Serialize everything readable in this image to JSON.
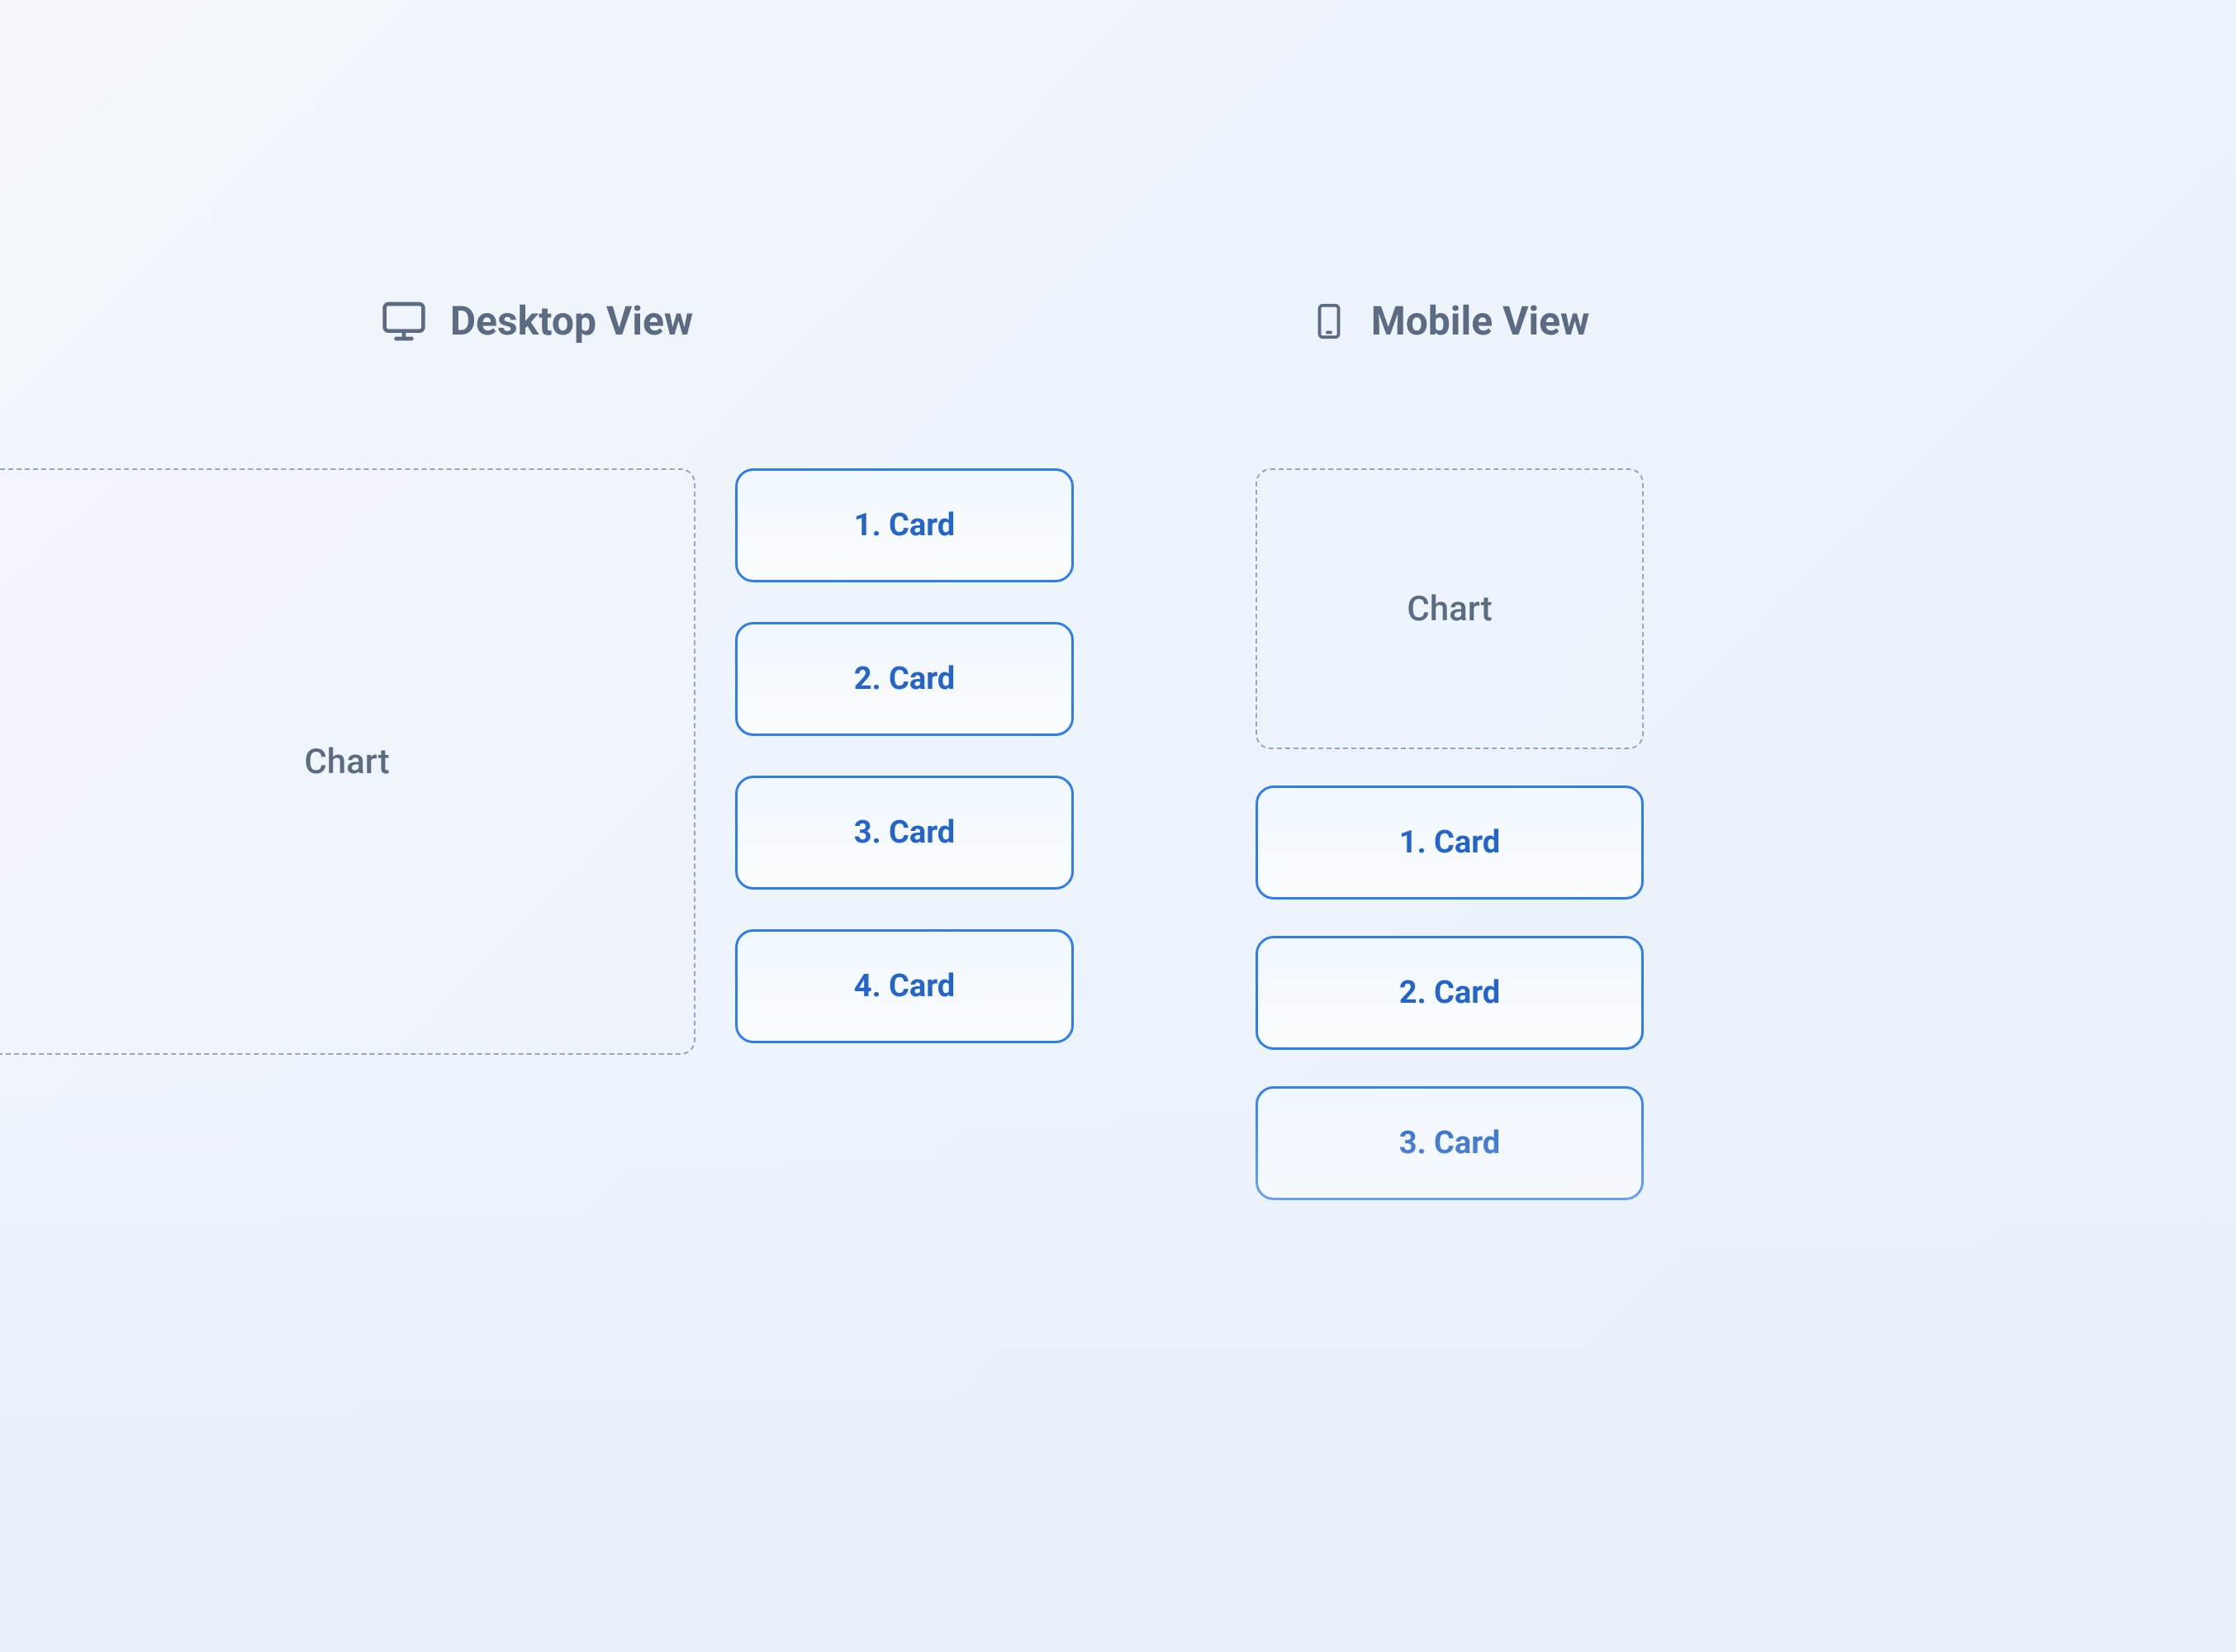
{
  "desktop": {
    "title": "Desktop View",
    "chartLabel": "Chart",
    "cards": [
      {
        "label": "1. Card"
      },
      {
        "label": "2. Card"
      },
      {
        "label": "3. Card"
      },
      {
        "label": "4. Card"
      }
    ]
  },
  "mobile": {
    "title": "Mobile View",
    "chartLabel": "Chart",
    "cards": [
      {
        "label": "1. Card"
      },
      {
        "label": "2. Card"
      },
      {
        "label": "3. Card"
      }
    ]
  }
}
